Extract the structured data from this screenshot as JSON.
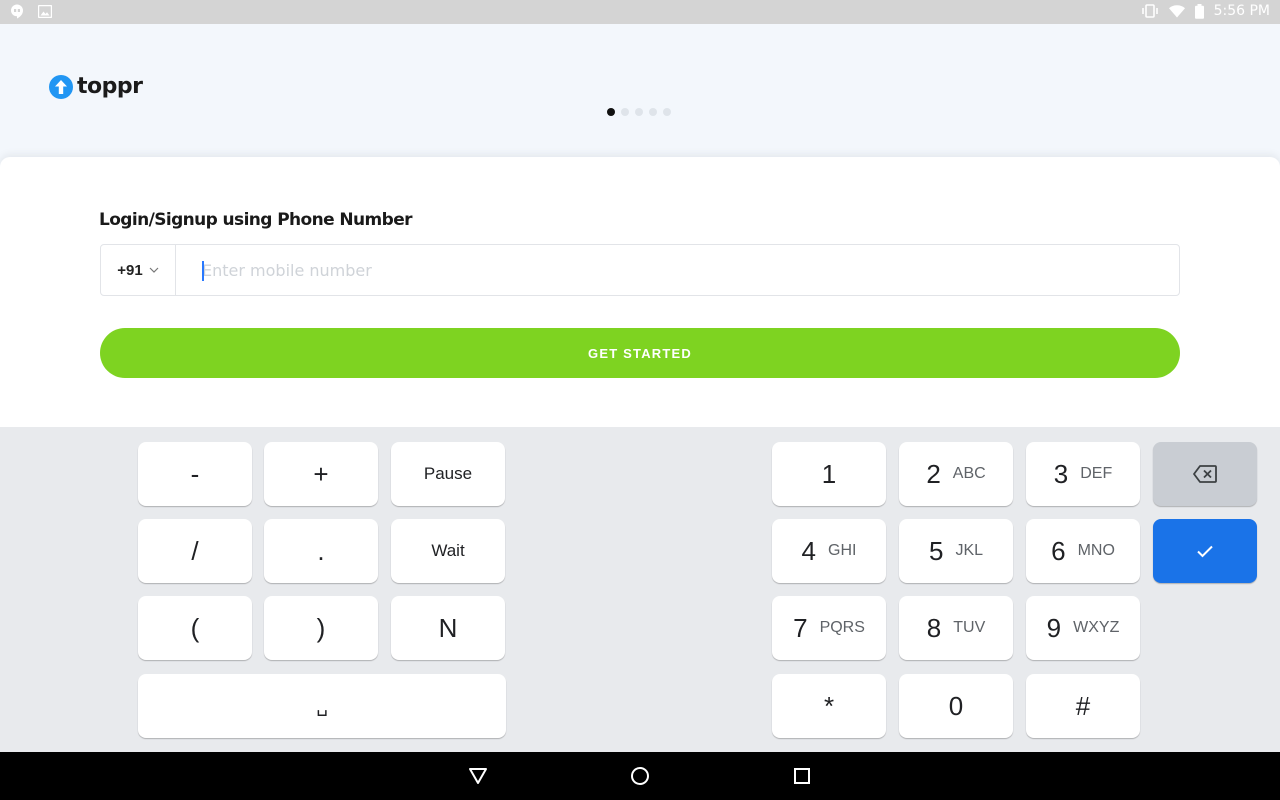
{
  "status_bar": {
    "time": "5:56 PM",
    "left_icons": [
      "hangouts-icon",
      "image-icon"
    ],
    "right_icons": [
      "vibrate-icon",
      "wifi-icon",
      "battery-icon"
    ]
  },
  "header": {
    "logo_text": "toppr",
    "carousel_dots": 5,
    "active_dot": 0
  },
  "login": {
    "title": "Login/Signup using Phone Number",
    "country_code": "+91",
    "phone_placeholder": "Enter mobile number",
    "phone_value": "",
    "cta_label": "GET STARTED"
  },
  "keyboard": {
    "symbol_keys": [
      "-",
      "+",
      "Pause",
      "/",
      ".",
      "Wait",
      "(",
      ")",
      "N"
    ],
    "space_key": "␣",
    "digit_keys": [
      {
        "num": "1",
        "letters": ""
      },
      {
        "num": "2",
        "letters": "ABC"
      },
      {
        "num": "3",
        "letters": "DEF"
      },
      {
        "num": "4",
        "letters": "GHI"
      },
      {
        "num": "5",
        "letters": "JKL"
      },
      {
        "num": "6",
        "letters": "MNO"
      },
      {
        "num": "7",
        "letters": "PQRS"
      },
      {
        "num": "8",
        "letters": "TUV"
      },
      {
        "num": "9",
        "letters": "WXYZ"
      },
      {
        "num": "*",
        "letters": ""
      },
      {
        "num": "0",
        "letters": ""
      },
      {
        "num": "#",
        "letters": ""
      }
    ],
    "backspace_icon": "backspace-icon",
    "done_icon": "checkmark-icon"
  },
  "colors": {
    "accent_green": "#7ed321",
    "keyboard_blue": "#1a73e8",
    "logo_blue": "#2196f3"
  }
}
